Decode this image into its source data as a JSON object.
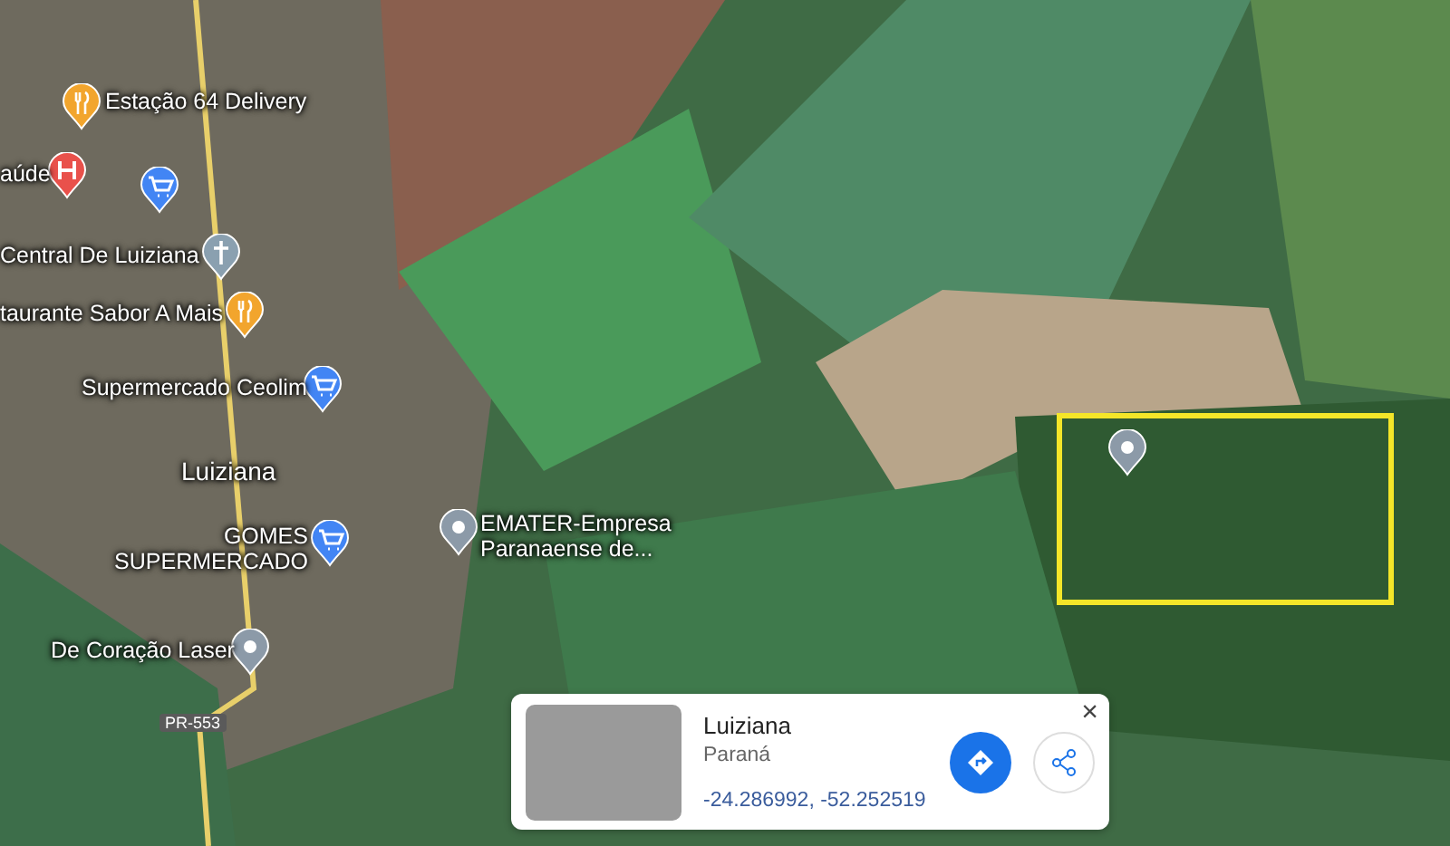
{
  "map": {
    "places": [
      {
        "kind": "restaurant",
        "label": "Estação 64 Delivery"
      },
      {
        "kind": "hospital",
        "label": "aúde"
      },
      {
        "kind": "shop"
      },
      {
        "kind": "church",
        "label": "Central De Luiziana"
      },
      {
        "kind": "restaurant",
        "label": "taurante Sabor A Mais"
      },
      {
        "kind": "shop",
        "label": "Supermercado Ceolim"
      },
      {
        "kind": "town",
        "label": "Luiziana"
      },
      {
        "kind": "shop",
        "label": "GOMES SUPERMERCADO"
      },
      {
        "kind": "place",
        "label": "EMATER-Empresa Paranaense de..."
      },
      {
        "kind": "place",
        "label": "De Coração Laser"
      },
      {
        "kind": "selected"
      }
    ],
    "road_label": "PR-553"
  },
  "place_card": {
    "title": "Luiziana",
    "subtitle": "Paraná",
    "coordinates": "-24.286992, -52.252519",
    "close": "×"
  }
}
